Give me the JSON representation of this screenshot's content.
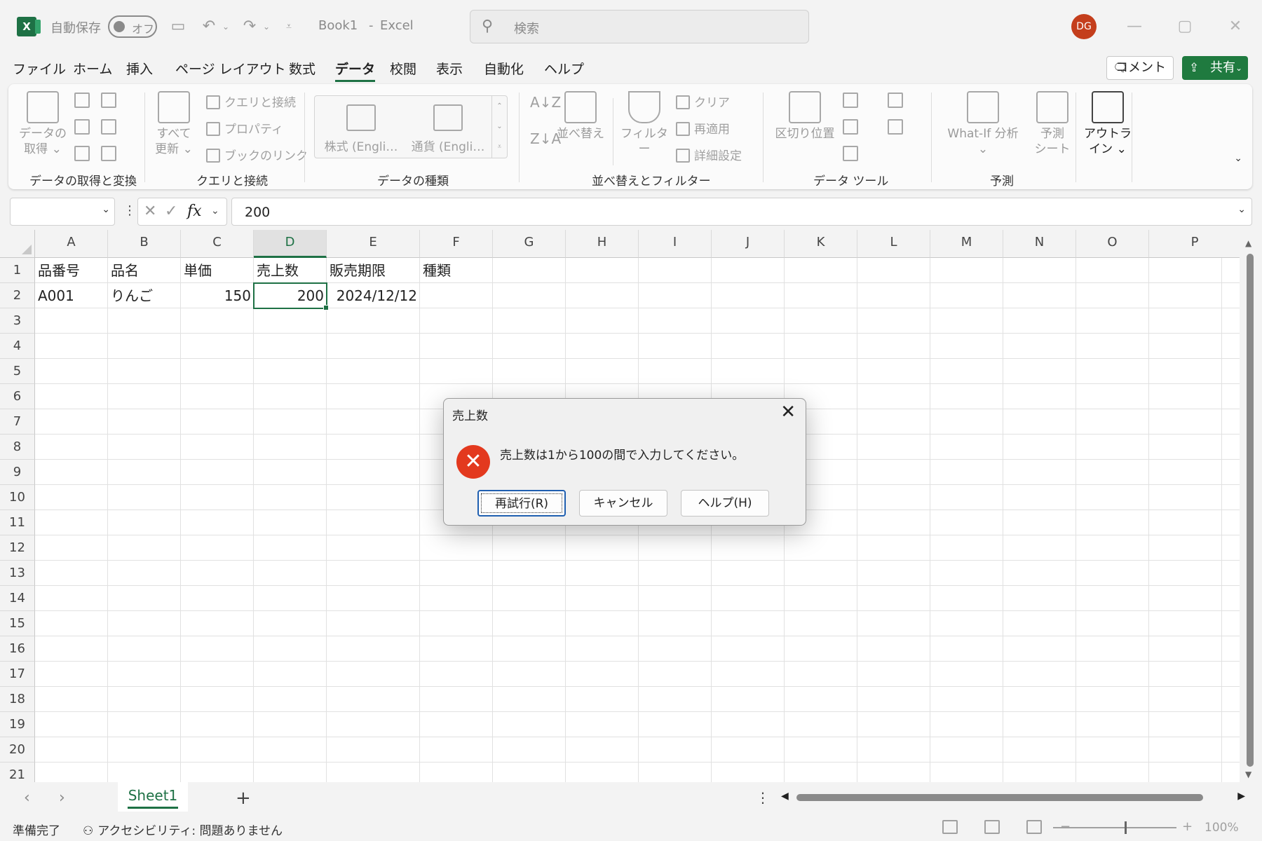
{
  "titlebar": {
    "autosave_label": "自動保存",
    "autosave_state": "オフ",
    "doc_title": "Book1",
    "separator": "-",
    "app_name": "Excel",
    "search_placeholder": "検索",
    "avatar_initials": "DG"
  },
  "menu": {
    "tabs": [
      "ファイル",
      "ホーム",
      "挿入",
      "ページ レイアウト",
      "数式",
      "データ",
      "校閲",
      "表示",
      "自動化",
      "ヘルプ"
    ],
    "active_tab": "データ",
    "comment_label": "コメント",
    "share_label": "共有"
  },
  "ribbon": {
    "groups": {
      "get_transform": {
        "label": "データの取得と変換",
        "get_data_line1": "データの",
        "get_data_line2": "取得"
      },
      "queries": {
        "label": "クエリと接続",
        "refresh_line1": "すべて",
        "refresh_line2": "更新",
        "queries_connections": "クエリと接続",
        "properties": "プロパティ",
        "workbook_links": "ブックのリンク"
      },
      "data_types": {
        "label": "データの種類",
        "stocks": "株式 (Engli…",
        "currencies": "通貨 (Engli…"
      },
      "sort_filter": {
        "label": "並べ替えとフィルター",
        "sort": "並べ替え",
        "filter": "フィルター",
        "clear": "クリア",
        "reapply": "再適用",
        "advanced": "詳細設定"
      },
      "data_tools": {
        "label": "データ ツール",
        "text_to_columns": "区切り位置"
      },
      "forecast": {
        "label": "予測",
        "whatif": "What-If 分析",
        "forecast_line1": "予測",
        "forecast_line2": "シート"
      },
      "outline": {
        "line1": "アウトラ",
        "line2": "イン"
      }
    }
  },
  "formula_bar": {
    "name_box": "",
    "fx_symbol": "fx",
    "value": "200"
  },
  "sheet": {
    "columns": [
      "A",
      "B",
      "C",
      "D",
      "E",
      "F",
      "G",
      "H",
      "I",
      "J",
      "K",
      "L",
      "M",
      "N",
      "O",
      "P"
    ],
    "selected_column": "D",
    "rows": [
      "1",
      "2",
      "3",
      "4",
      "5",
      "6",
      "7",
      "8",
      "9",
      "10",
      "11",
      "12",
      "13",
      "14",
      "15",
      "16",
      "17",
      "18",
      "19",
      "20",
      "21"
    ],
    "cells": {
      "A1": "品番号",
      "B1": "品名",
      "C1": "単価",
      "D1": "売上数",
      "E1": "販売期限",
      "F1": "種類",
      "A2": "A001",
      "B2": "りんご",
      "C2": "150",
      "D2": "200",
      "E2": "2024/12/12"
    }
  },
  "tabs": {
    "sheet_name": "Sheet1",
    "add_symbol": "+"
  },
  "status": {
    "ready": "準備完了",
    "accessibility": "アクセシビリティ: 問題ありません",
    "zoom": "100%"
  },
  "dialog": {
    "title": "売上数",
    "message": "売上数は1から100の間で入力してください。",
    "retry": "再試行(R)",
    "cancel": "キャンセル",
    "help": "ヘルプ(H)"
  },
  "colors": {
    "accent": "#1e7145",
    "share_button": "#1f7a3f",
    "avatar": "#c43e1c",
    "error_icon": "#e3391e"
  }
}
